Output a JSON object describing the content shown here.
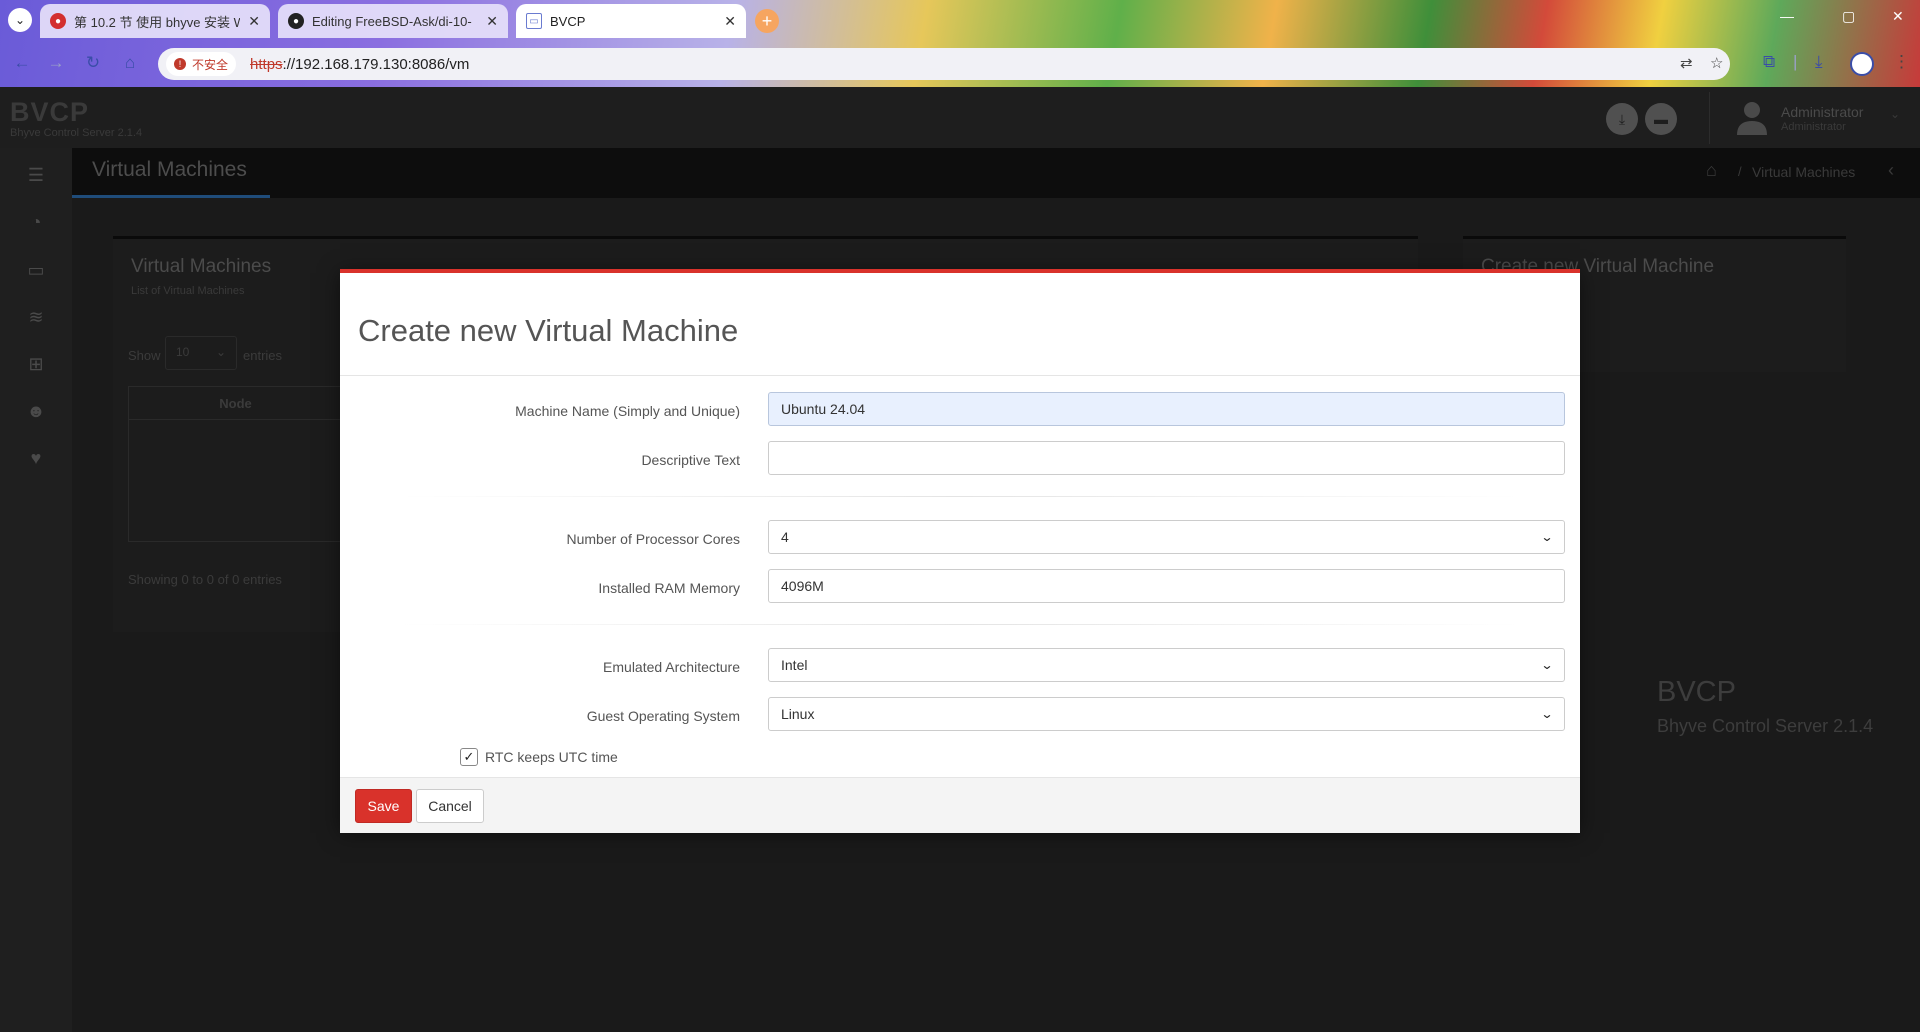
{
  "browser": {
    "tabs": [
      {
        "title": "第 10.2 节 使用 bhyve 安装 W",
        "active": false
      },
      {
        "title": "Editing FreeBSD-Ask/di-10-",
        "active": false
      },
      {
        "title": "BVCP",
        "active": true
      }
    ],
    "security_label": "不安全",
    "url_scheme": "https",
    "url_rest": "://192.168.179.130:8086/vm"
  },
  "app": {
    "logo_title": "BVCP",
    "logo_subtitle": "Bhyve Control Server 2.1.4",
    "user_name": "Administrator",
    "user_role": "Administrator",
    "page_title": "Virtual Machines",
    "breadcrumb_current": "Virtual Machines",
    "breadcrumb_sep": "/"
  },
  "background": {
    "list_panel_title": "Virtual Machines",
    "list_panel_subtitle": "List of Virtual Machines",
    "show_label": "Show",
    "entries_value": "10",
    "entries_label": "entries",
    "table_header_node": "Node",
    "showing_text": "Showing 0 to 0 of 0 entries",
    "create_panel_title": "Create new Virtual Machine",
    "brand_title": "BVCP",
    "brand_subtitle": "Bhyve Control Server 2.1.4"
  },
  "modal": {
    "title": "Create new Virtual Machine",
    "fields": {
      "machine_name_label": "Machine Name (Simply and Unique)",
      "machine_name_value": "Ubuntu 24.04",
      "description_label": "Descriptive Text",
      "description_value": "",
      "cores_label": "Number of Processor Cores",
      "cores_value": "4",
      "ram_label": "Installed RAM Memory",
      "ram_value": "4096M",
      "arch_label": "Emulated Architecture",
      "arch_value": "Intel",
      "os_label": "Guest Operating System",
      "os_value": "Linux",
      "rtc_label": "RTC keeps UTC time",
      "rtc_checked": true
    },
    "save_label": "Save",
    "cancel_label": "Cancel"
  },
  "colors": {
    "accent_red": "#d9322b",
    "input_autofill": "#e8f0fe",
    "browser_link": "#3a4da8"
  }
}
